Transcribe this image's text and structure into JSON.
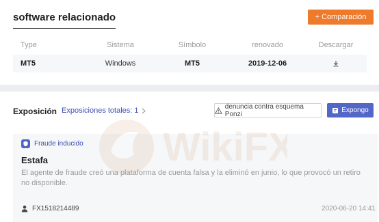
{
  "software": {
    "title": "software relacionado",
    "compare_label": "Comparación",
    "headers": [
      "Type",
      "Sistema",
      "Símbolo",
      "renovado",
      "Descargar"
    ],
    "row": {
      "type": "MT5",
      "system": "Windows",
      "symbol": "MT5",
      "updated": "2019-12-06"
    }
  },
  "exposure": {
    "title": "Exposición",
    "total": "Exposiciones totales: 1",
    "report_label": "denuncia contra esquema Ponzi",
    "expose_label": "Expongo",
    "item": {
      "tag": "Fraude inducido",
      "title": "Estafa",
      "description": "El agente de fraude creó una plataforma de cuenta falsa y la eliminó en junio, lo que provocó un retiro no disponible.",
      "user": "FX1518214489",
      "date": "2020-06-20 14:41"
    }
  },
  "watermark": "WikiFX",
  "colors": {
    "accent_orange": "#ee7a2b",
    "accent_blue": "#5367c7",
    "link_blue": "#3a4fb0"
  }
}
